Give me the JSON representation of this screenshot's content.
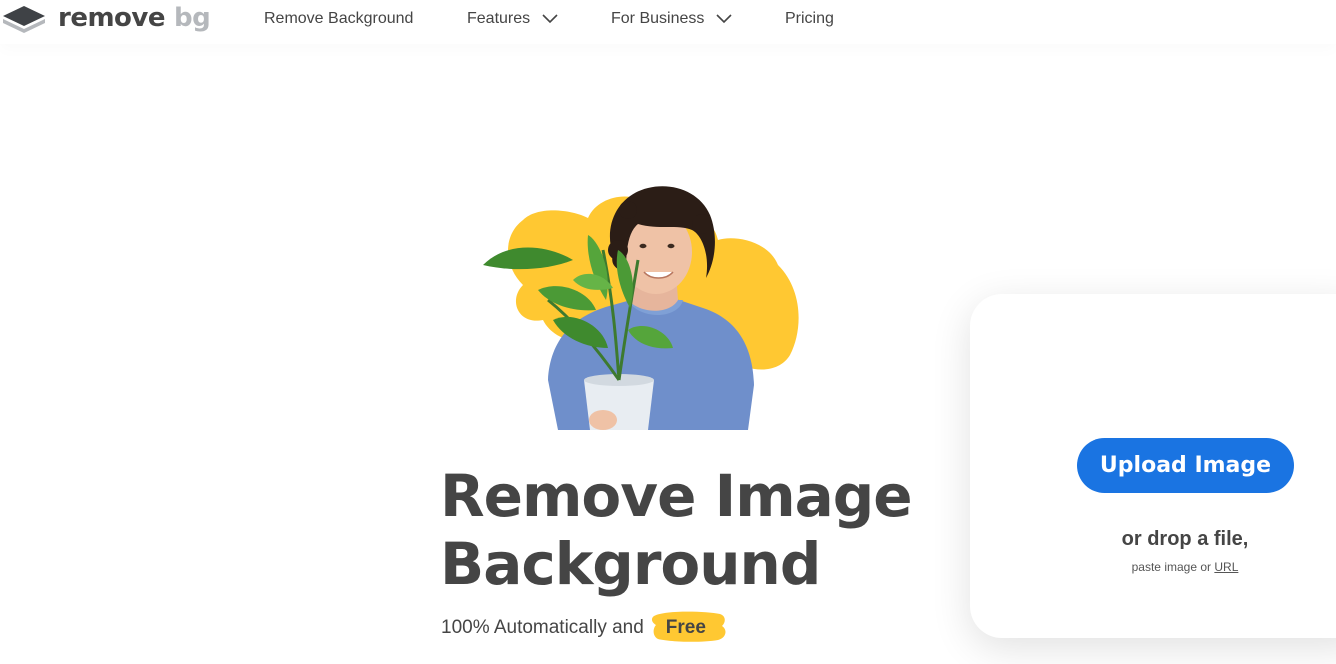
{
  "brand": {
    "name_primary": "remove",
    "name_secondary": "bg",
    "text_color": "#454545",
    "secondary_color": "#b5b8bc"
  },
  "nav": {
    "items": [
      {
        "label": "Remove Background",
        "has_dropdown": false
      },
      {
        "label": "Features",
        "has_dropdown": true,
        "icon": "chevron-down-icon"
      },
      {
        "label": "For Business",
        "has_dropdown": true,
        "icon": "chevron-down-icon"
      },
      {
        "label": "Pricing",
        "has_dropdown": false
      }
    ]
  },
  "hero": {
    "illustration": "person-holding-plant-image",
    "blob_color": "#ffc832",
    "headline_line1": "Remove Image",
    "headline_line2": "Background",
    "subline_prefix": "100% Automatically and",
    "subline_highlight": "Free",
    "highlight_color": "#ffc832"
  },
  "upload": {
    "button_label": "Upload Image",
    "button_color": "#1a74e2",
    "drop_text": "or drop a file,",
    "paste_prefix": "paste image or",
    "paste_link": "URL"
  }
}
